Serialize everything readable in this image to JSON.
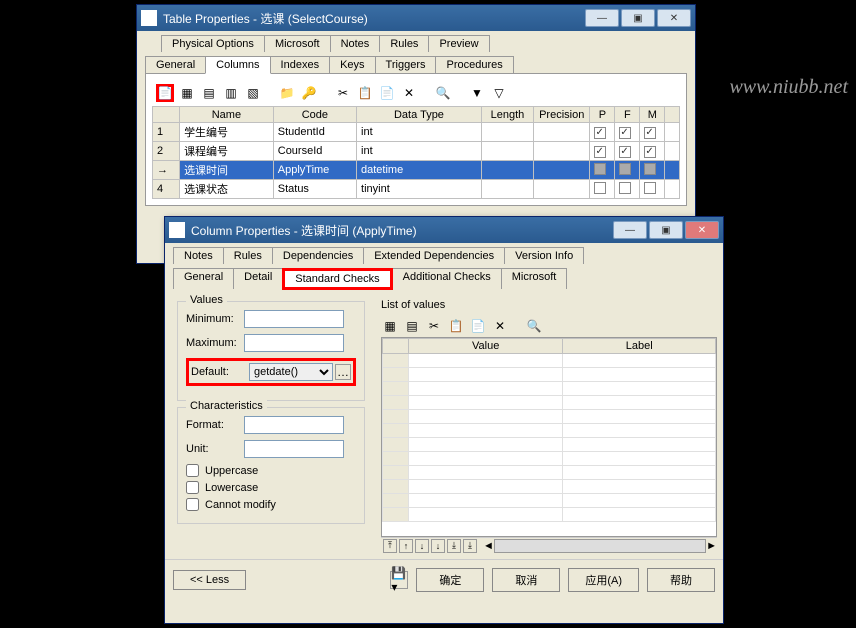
{
  "watermark": "www.niubb.net",
  "tableWin": {
    "title": "Table Properties - 选课 (SelectCourse)",
    "tabsTop": [
      "Physical Options",
      "Microsoft",
      "Notes",
      "Rules",
      "Preview"
    ],
    "tabsBottom": [
      "General",
      "Columns",
      "Indexes",
      "Keys",
      "Triggers",
      "Procedures"
    ],
    "activeTab": "Columns",
    "gridHeaders": [
      "",
      "Name",
      "Code",
      "Data Type",
      "Length",
      "Precision",
      "P",
      "F",
      "M"
    ],
    "rows": [
      {
        "n": "1",
        "name": "学生编号",
        "code": "StudentId",
        "type": "int",
        "len": "",
        "prec": "",
        "p": true,
        "f": true,
        "m": true
      },
      {
        "n": "2",
        "name": "课程编号",
        "code": "CourseId",
        "type": "int",
        "len": "",
        "prec": "",
        "p": true,
        "f": true,
        "m": true
      },
      {
        "n": "→",
        "name": "选课时间",
        "code": "ApplyTime",
        "type": "datetime",
        "len": "",
        "prec": "",
        "p": false,
        "f": false,
        "m": false,
        "selected": true
      },
      {
        "n": "4",
        "name": "选课状态",
        "code": "Status",
        "type": "tinyint",
        "len": "",
        "prec": "",
        "p": false,
        "f": false,
        "m": false
      }
    ],
    "winControls": {
      "min": "—",
      "max": "▣",
      "close": "✕"
    }
  },
  "colWin": {
    "title": "Column Properties - 选课时间 (ApplyTime)",
    "tabsTop": [
      "Notes",
      "Rules",
      "Dependencies",
      "Extended Dependencies",
      "Version Info"
    ],
    "tabsBottom": [
      "General",
      "Detail",
      "Standard Checks",
      "Additional Checks",
      "Microsoft"
    ],
    "activeTab": "Standard Checks",
    "values": {
      "legend": "Values",
      "minLabel": "Minimum:",
      "minVal": "",
      "maxLabel": "Maximum:",
      "maxVal": "",
      "defLabel": "Default:",
      "defVal": "getdate()"
    },
    "chars": {
      "legend": "Characteristics",
      "formatLabel": "Format:",
      "formatVal": "",
      "unitLabel": "Unit:",
      "unitVal": "",
      "upper": "Uppercase",
      "lower": "Lowercase",
      "nomod": "Cannot modify"
    },
    "listLabel": "List of values",
    "valHeaders": [
      "",
      "Value",
      "Label"
    ],
    "buttons": {
      "less": "<< Less",
      "ok": "确定",
      "cancel": "取消",
      "apply": "应用(A)",
      "help": "帮助"
    },
    "winControls": {
      "min": "—",
      "max": "▣",
      "close": "✕"
    }
  }
}
